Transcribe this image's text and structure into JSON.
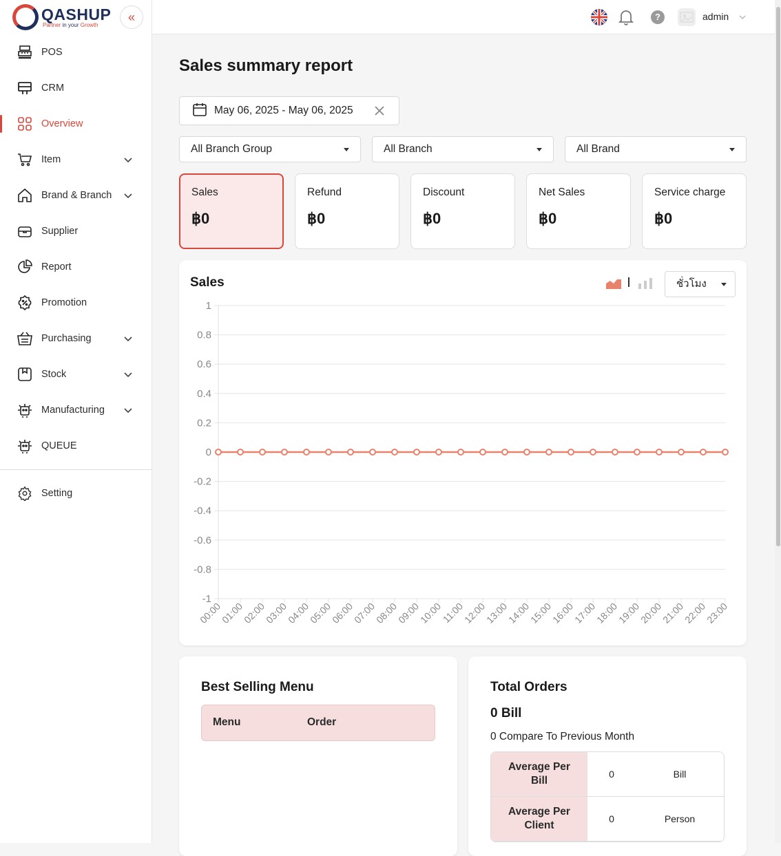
{
  "app": {
    "name": "QASHUP",
    "tagline_part1": "Partner",
    "tagline_part2": "in your",
    "tagline_part3": "Growth"
  },
  "sidebar": {
    "items": [
      {
        "label": "POS",
        "icon": "cash-register-icon",
        "chevron": false
      },
      {
        "label": "CRM",
        "icon": "crm-terminal-icon",
        "chevron": false
      },
      {
        "label": "Overview",
        "icon": "grid-icon",
        "chevron": false,
        "active": true
      },
      {
        "label": "Item",
        "icon": "cart-icon",
        "chevron": true
      },
      {
        "label": "Brand & Branch",
        "icon": "house-icon",
        "chevron": true
      },
      {
        "label": "Supplier",
        "icon": "box-icon",
        "chevron": false
      },
      {
        "label": "Report",
        "icon": "pie-chart-icon",
        "chevron": false
      },
      {
        "label": "Promotion",
        "icon": "discount-badge-icon",
        "chevron": false
      },
      {
        "label": "Purchasing",
        "icon": "basket-icon",
        "chevron": true
      },
      {
        "label": "Stock",
        "icon": "stock-tag-icon",
        "chevron": true
      },
      {
        "label": "Manufacturing",
        "icon": "robot-icon",
        "chevron": true
      },
      {
        "label": "QUEUE",
        "icon": "robot-icon",
        "chevron": false
      }
    ],
    "setting": {
      "label": "Setting",
      "icon": "gear-icon"
    }
  },
  "topbar": {
    "username": "admin",
    "help": "?"
  },
  "page": {
    "title": "Sales summary report"
  },
  "filters": {
    "date_range": "May 06, 2025 - May 06, 2025",
    "branch_group": "All Branch Group",
    "branch": "All Branch",
    "brand": "All Brand"
  },
  "cards": [
    {
      "label": "Sales",
      "value": "฿0"
    },
    {
      "label": "Refund",
      "value": "฿0"
    },
    {
      "label": "Discount",
      "value": "฿0"
    },
    {
      "label": "Net Sales",
      "value": "฿0"
    },
    {
      "label": "Service charge",
      "value": "฿0"
    }
  ],
  "sales_panel": {
    "title": "Sales",
    "period": "ชั่วโมง",
    "separator": "|"
  },
  "chart_data": {
    "type": "line",
    "title": "Sales",
    "categories": [
      "00:00",
      "01:00",
      "02:00",
      "03:00",
      "04:00",
      "05:00",
      "06:00",
      "07:00",
      "08:00",
      "09:00",
      "10:00",
      "11:00",
      "12:00",
      "13:00",
      "14:00",
      "15:00",
      "16:00",
      "17:00",
      "18:00",
      "19:00",
      "20:00",
      "21:00",
      "22:00",
      "23:00"
    ],
    "series": [
      {
        "values": [
          0,
          0,
          0,
          0,
          0,
          0,
          0,
          0,
          0,
          0,
          0,
          0,
          0,
          0,
          0,
          0,
          0,
          0,
          0,
          0,
          0,
          0,
          0,
          0
        ]
      }
    ],
    "yticks": [
      "1",
      "0.8",
      "0.6",
      "0.4",
      "0.2",
      "0",
      "-0.2",
      "-0.4",
      "-0.6",
      "-0.8",
      "-1"
    ],
    "ylim": [
      -1,
      1
    ],
    "grid": true,
    "color": "#e8826a"
  },
  "best_selling": {
    "title": "Best Selling Menu",
    "col_menu": "Menu",
    "col_order": "Order"
  },
  "total_orders": {
    "title": "Total Orders",
    "bill_count": "0  Bill",
    "compare": "0 Compare To Previous Month",
    "rows": [
      {
        "head": "Average Per Bill",
        "value": "0",
        "unit": "Bill"
      },
      {
        "head": "Average Per Client",
        "value": "0",
        "unit": "Person"
      }
    ]
  },
  "colors": {
    "accent": "#d9473b",
    "navy": "#1f2f5c",
    "line": "#e8826a",
    "card_active_bg": "#fbe9e9"
  }
}
